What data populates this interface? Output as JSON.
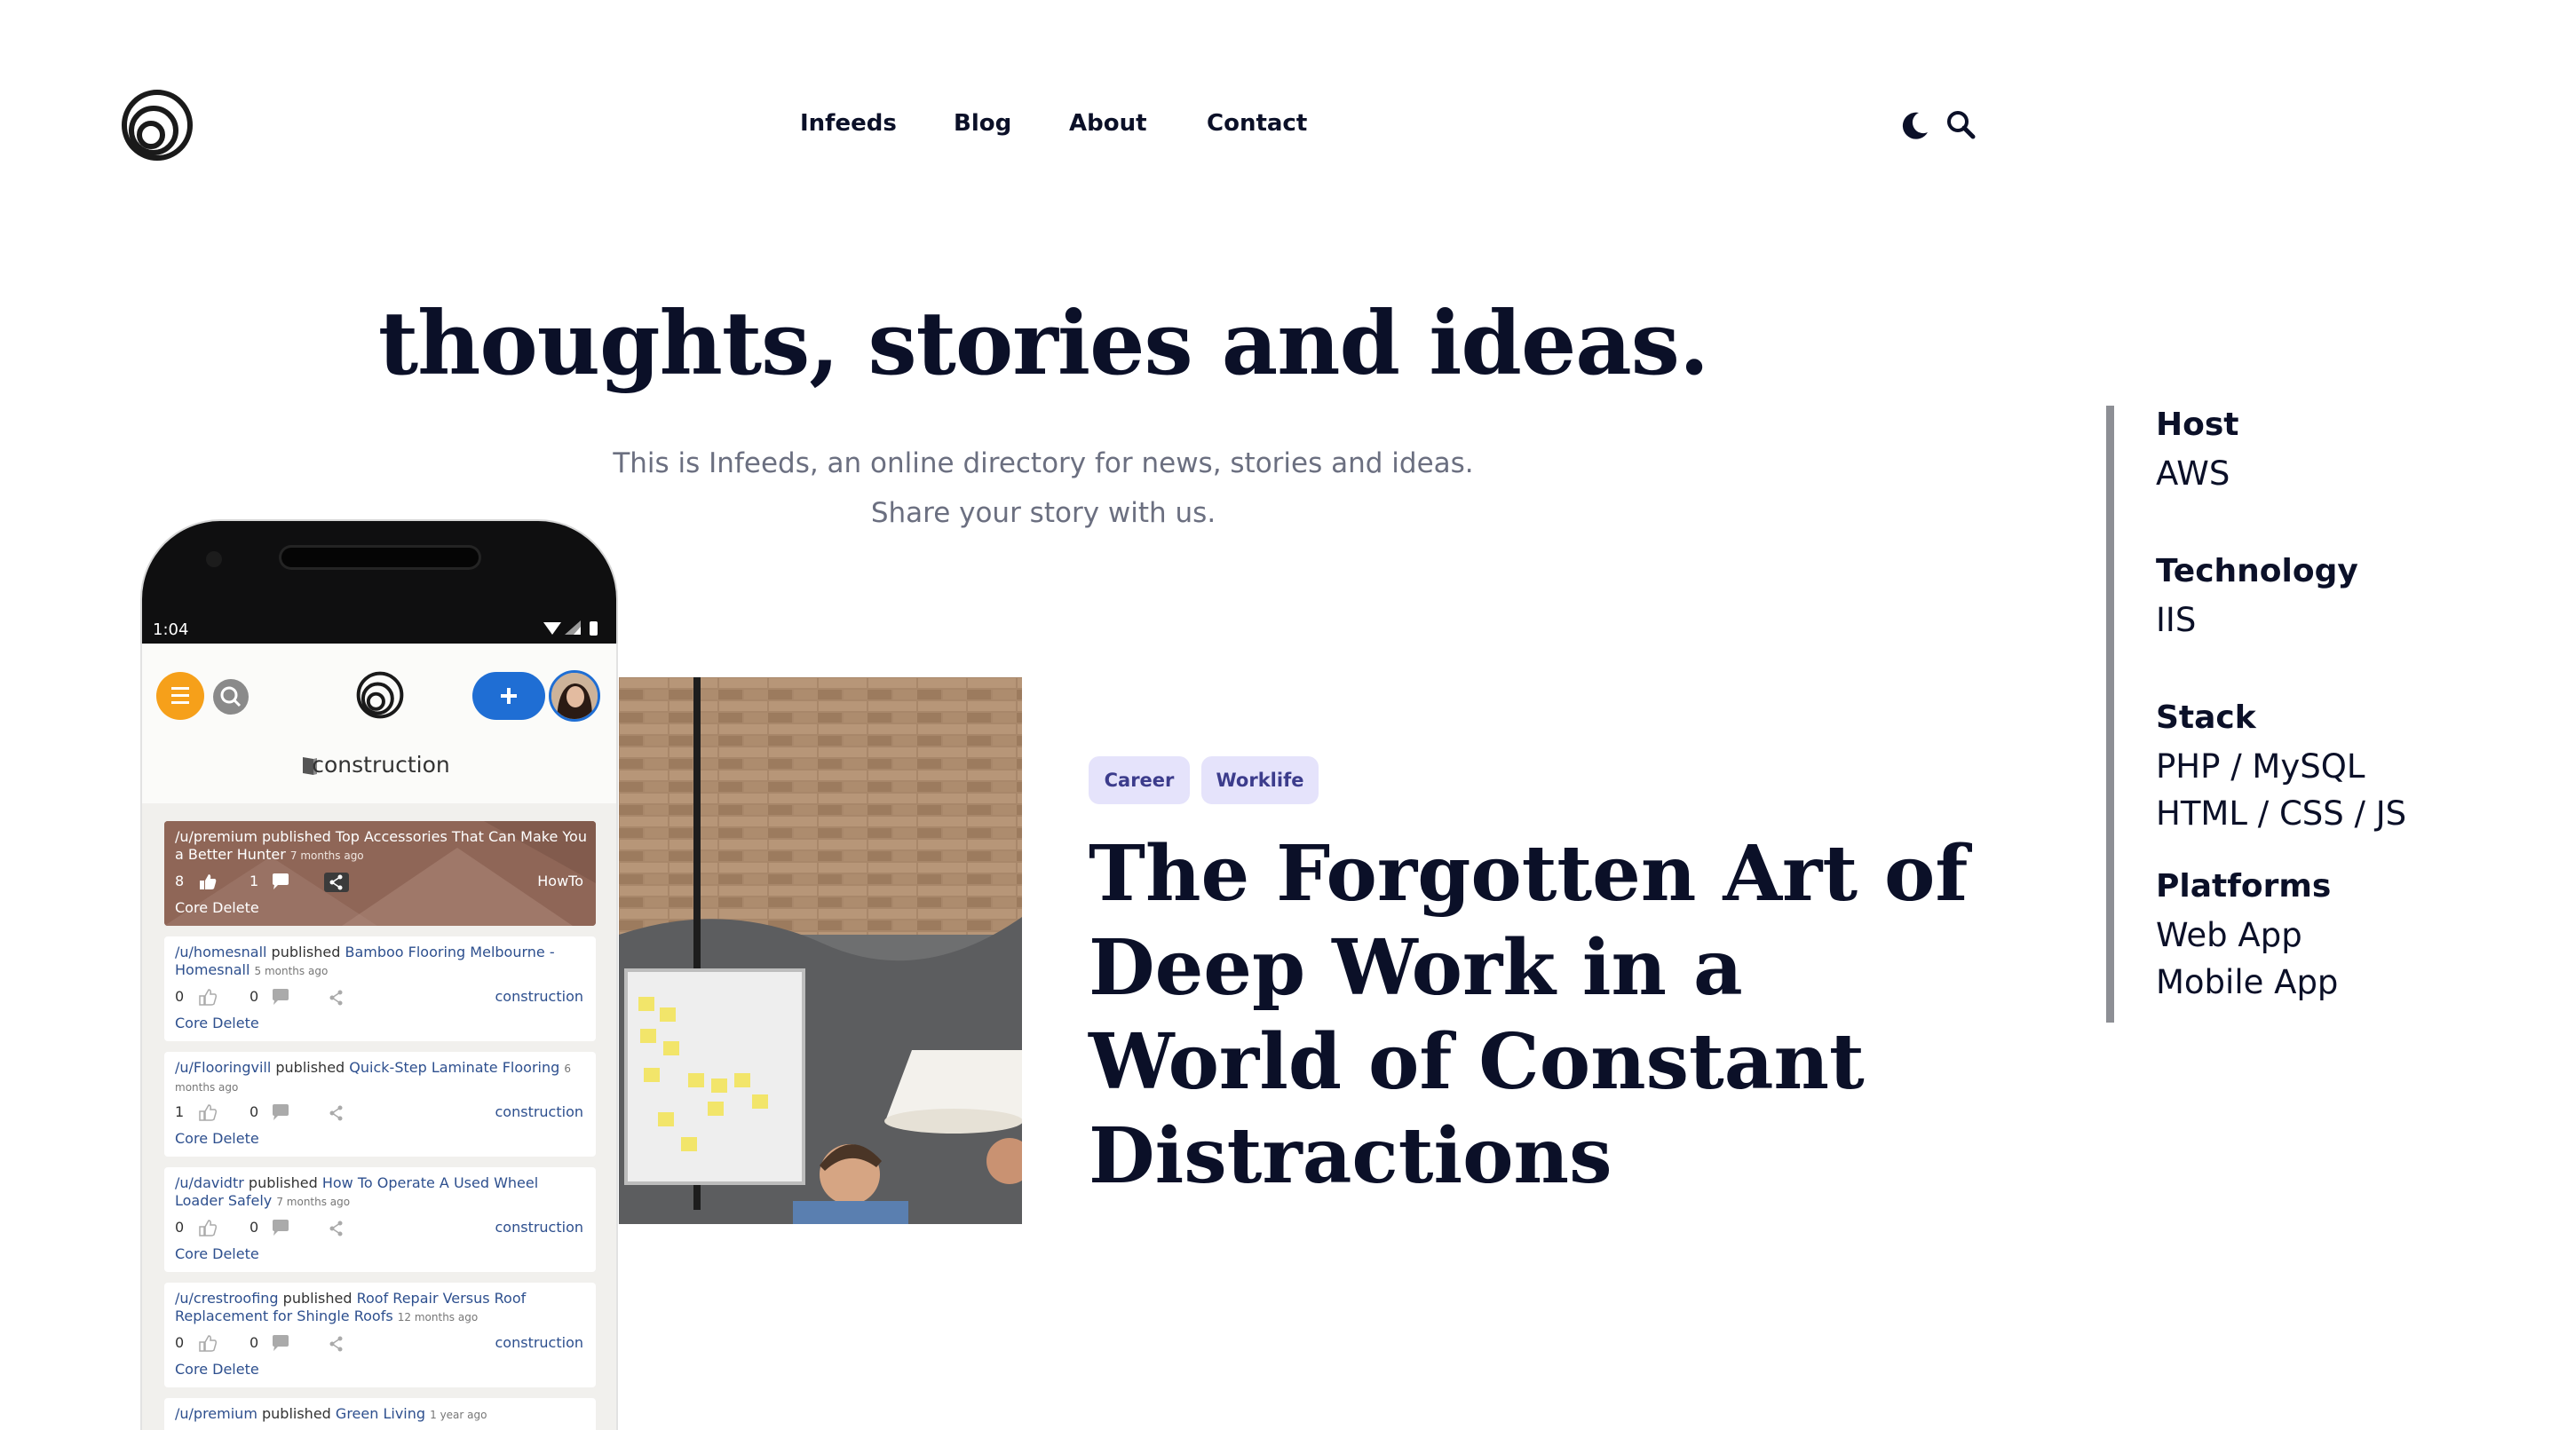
{
  "nav": {
    "items": [
      "Infeeds",
      "Blog",
      "About",
      "Contact"
    ]
  },
  "header_icons": [
    "moon-icon",
    "search-icon"
  ],
  "hero": {
    "title": "thoughts, stories and ideas.",
    "subtitle_line1": "This is Infeeds, an online directory for news, stories and ideas.",
    "subtitle_line2": "Share your story with us."
  },
  "sidebar": {
    "sections": [
      {
        "heading": "Host",
        "values": [
          "AWS"
        ]
      },
      {
        "heading": "Technology",
        "values": [
          "IIS"
        ]
      },
      {
        "heading": "Stack",
        "values": [
          "PHP / MySQL",
          "HTML / CSS / JS"
        ]
      },
      {
        "heading": "Platforms",
        "values": [
          "Web App",
          "Mobile App"
        ]
      }
    ]
  },
  "article": {
    "tags": [
      "Career",
      "Worklife"
    ],
    "title": "The Forgotten Art of Deep Work in a World of Constant Distractions"
  },
  "phone": {
    "status_time": "1:04",
    "category": "construction",
    "feed": [
      {
        "user": "/u/premium",
        "verb": "published",
        "title": "Top Accessories That Can Make You a Better Hunter",
        "time": "7 months ago",
        "likes": "8",
        "comments": "1",
        "category": "HowTo",
        "admin": "Core Delete"
      },
      {
        "user": "/u/homesnall",
        "verb": "published",
        "title": "Bamboo Flooring Melbourne - Homesnall",
        "time": "5 months ago",
        "likes": "0",
        "comments": "0",
        "category": "construction",
        "admin": "Core Delete"
      },
      {
        "user": "/u/Flooringvill",
        "verb": "published",
        "title": "Quick-Step Laminate Flooring",
        "time": "6 months ago",
        "likes": "1",
        "comments": "0",
        "category": "construction",
        "admin": "Core Delete"
      },
      {
        "user": "/u/davidtr",
        "verb": "published",
        "title": "How To Operate A Used Wheel Loader Safely",
        "time": "7 months ago",
        "likes": "0",
        "comments": "0",
        "category": "construction",
        "admin": "Core Delete"
      },
      {
        "user": "/u/crestroofing",
        "verb": "published",
        "title": "Roof Repair Versus Roof Replacement for Shingle Roofs",
        "time": "12 months ago",
        "likes": "0",
        "comments": "0",
        "category": "construction",
        "admin": "Core Delete"
      },
      {
        "user": "/u/premium",
        "verb": "published",
        "title": "Green Living",
        "time": "1 year ago"
      }
    ]
  },
  "colors": {
    "text": "#0b1028",
    "muted": "#6b6f80",
    "tag_bg": "#e5e3fb",
    "tag_text": "#3c3c8c",
    "accent_orange": "#f6a01a",
    "accent_blue": "#1f6ed4",
    "side_bar": "#8d8f95"
  }
}
